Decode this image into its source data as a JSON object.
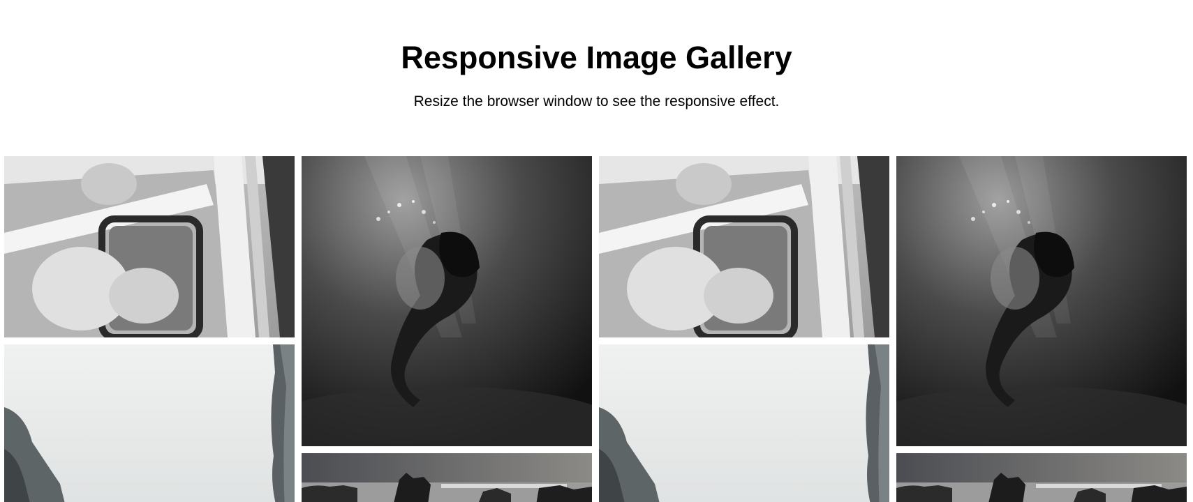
{
  "header": {
    "title": "Responsive Image Gallery",
    "subtitle": "Resize the browser window to see the responsive effect."
  },
  "gallery": {
    "columns": [
      {
        "images": [
          {
            "subject": "couple-in-car"
          },
          {
            "subject": "foggy-cliff"
          }
        ]
      },
      {
        "images": [
          {
            "subject": "underwater-woman"
          },
          {
            "subject": "rocky-coast"
          }
        ]
      },
      {
        "images": [
          {
            "subject": "couple-in-car"
          },
          {
            "subject": "foggy-cliff"
          }
        ]
      },
      {
        "images": [
          {
            "subject": "underwater-woman"
          },
          {
            "subject": "rocky-coast"
          }
        ]
      }
    ]
  }
}
